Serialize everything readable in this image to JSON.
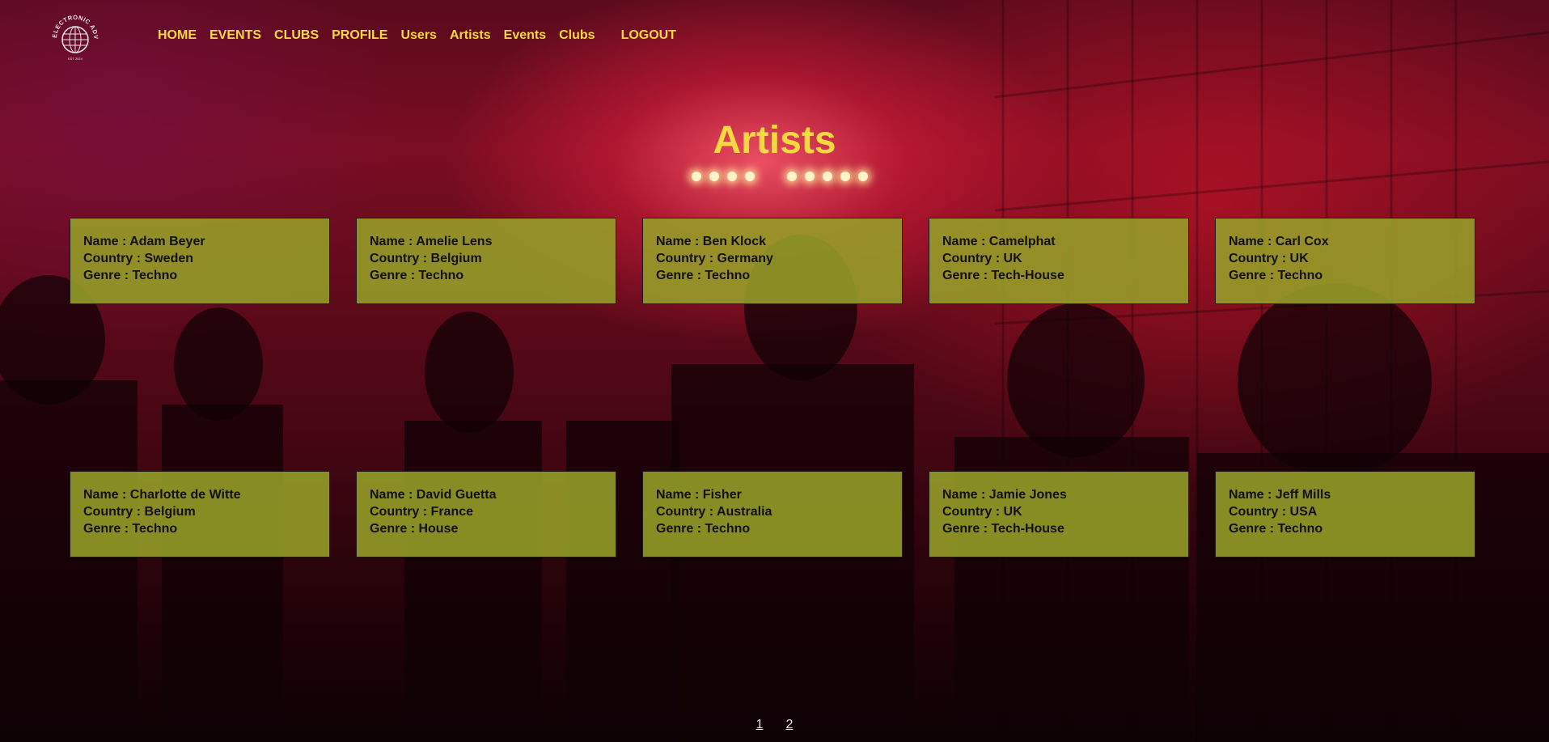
{
  "logo": {
    "text": "ELECTRONIC ADVISOR",
    "subtext": "EST 2024",
    "icon": "globe-icon"
  },
  "nav": {
    "items": [
      "HOME",
      "EVENTS",
      "CLUBS",
      "PROFILE",
      "Users",
      "Artists",
      "Events",
      "Clubs"
    ],
    "logout": "LOGOUT",
    "color": "#f5d842"
  },
  "page_title": "Artists",
  "labels": {
    "name": "Name : ",
    "country": "Country : ",
    "genre": "Genre : "
  },
  "artists": [
    {
      "name": "Adam Beyer",
      "country": "Sweden",
      "genre": "Techno"
    },
    {
      "name": "Amelie Lens",
      "country": "Belgium",
      "genre": "Techno"
    },
    {
      "name": "Ben Klock",
      "country": "Germany",
      "genre": "Techno"
    },
    {
      "name": "Camelphat",
      "country": "UK",
      "genre": "Tech-House"
    },
    {
      "name": "Carl Cox",
      "country": "UK",
      "genre": "Techno"
    },
    {
      "name": "Charlotte de Witte",
      "country": "Belgium",
      "genre": "Techno"
    },
    {
      "name": "David Guetta",
      "country": "France",
      "genre": "House"
    },
    {
      "name": "Fisher",
      "country": "Australia",
      "genre": "Techno"
    },
    {
      "name": "Jamie Jones",
      "country": "UK",
      "genre": "Tech-House"
    },
    {
      "name": "Jeff Mills",
      "country": "USA",
      "genre": "Techno"
    }
  ],
  "pagination": {
    "pages": [
      "1",
      "2"
    ]
  },
  "colors": {
    "accent": "#f5d842",
    "card_bg": "#96a028",
    "background": "#7a0d22"
  }
}
